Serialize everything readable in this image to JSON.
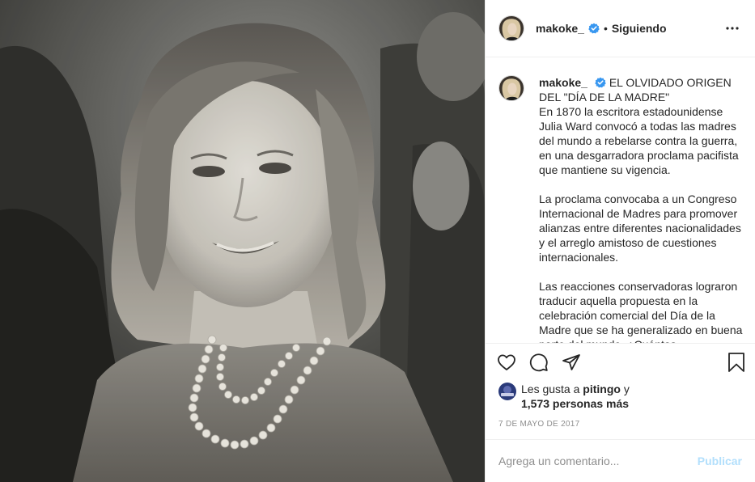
{
  "post": {
    "username": "makoke_",
    "separator": "•",
    "follow_status": "Siguiendo",
    "caption": {
      "headline": "EL OLVIDADO ORIGEN DEL \"DÍA DE LA MADRE\"",
      "para1": "En 1870 la escritora estadounidense Julia Ward convocó a todas las madres del mundo a rebelarse contra la guerra, en una desgarradora proclama pacifista que mantiene su vigencia.",
      "para2": "La proclama convocaba a un Congreso Internacional de Madres para promover alianzas entre diferentes nacionalidades y el arreglo amistoso de cuestiones internacionales.",
      "para3": "Las reacciones conservadoras lograron traducir aquella propuesta en la celebración comercial del Día de la Madre que se ha generalizado en buena parte del mundo. ¿Cuántas..."
    },
    "likes": {
      "prefix": "Les gusta a",
      "first_user": "pitingo",
      "joiner": "y",
      "others": "1,573 personas más",
      "avatar_label": "pitingo"
    },
    "date": "7 DE MAYO DE 2017",
    "comment": {
      "placeholder": "Agrega un comentario...",
      "publish_label": "Publicar"
    }
  },
  "icons": {
    "verified": "verified-badge-icon",
    "more": "more-options-icon",
    "like": "heart-icon",
    "comment": "comment-icon",
    "share": "share-icon",
    "save": "bookmark-icon"
  },
  "colors": {
    "verified_blue": "#3897f0",
    "publish_disabled": "#b2dffc",
    "muted_text": "#8e8e8e",
    "divider": "#efefef"
  }
}
